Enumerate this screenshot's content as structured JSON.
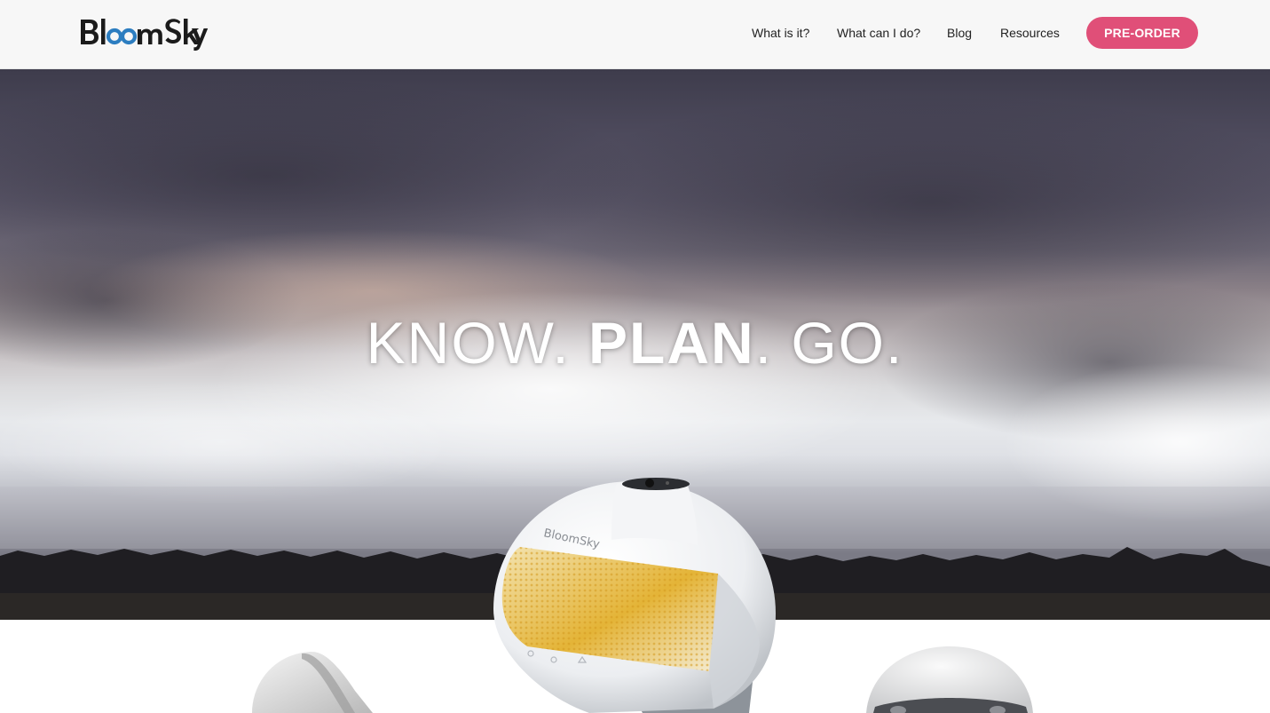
{
  "header": {
    "logo_text": "BloomSky",
    "nav": [
      {
        "label": "What is it?"
      },
      {
        "label": "What can I do?"
      },
      {
        "label": "Blog"
      },
      {
        "label": "Resources"
      }
    ],
    "cta_label": "PRE-ORDER"
  },
  "hero": {
    "tagline_part1": "KNOW. ",
    "tagline_part2": "PLAN",
    "tagline_part3": ". GO."
  },
  "product": {
    "device_brand": "BloomSky"
  },
  "colors": {
    "accent": "#e04f78",
    "logo_blue": "#2c7dc0",
    "header_bg": "#f7f7f7"
  }
}
